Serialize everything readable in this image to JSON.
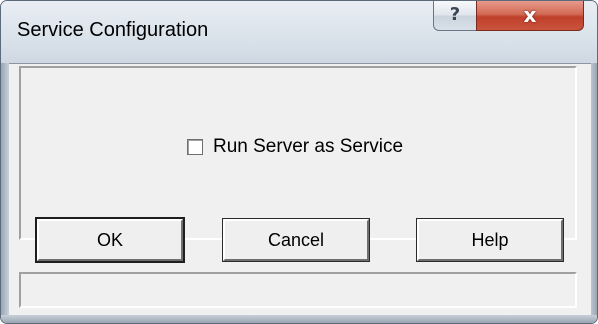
{
  "window": {
    "title": "Service Configuration",
    "help_glyph": "?",
    "close_glyph": "x",
    "accent_color": "#c0402a"
  },
  "options": {
    "run_as_service_label": "Run Server as Service",
    "run_as_service_checked": false
  },
  "buttons": {
    "ok_label": "OK",
    "cancel_label": "Cancel",
    "help_label": "Help"
  },
  "statusbar": {
    "text": ""
  },
  "icons": {
    "help": "question-mark-icon",
    "close": "close-icon"
  }
}
